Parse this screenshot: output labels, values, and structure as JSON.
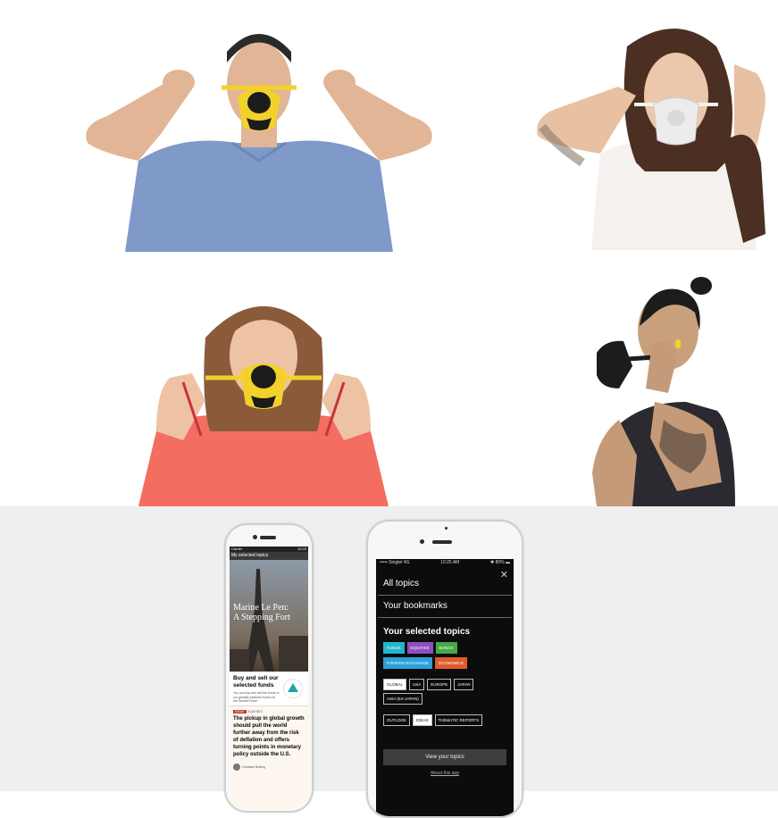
{
  "left_phone": {
    "status_left": "Carrier",
    "status_right": "10:25",
    "nav_label": "My selected topics",
    "hero_title": "Marine Le Pen: A Stepping Fort",
    "card_title": "Buy and sell our selected funds",
    "card_body": "You can buy and sell the funds of our globally selected funds via the Wealth Portal",
    "tag_label": "IDEAS",
    "tag_meta": "EQUITIES",
    "quote": "The pickup in global growth should pull the world further away from the risk of deflation and offers turning points in monetary policy outside the U.S.",
    "author": "Christian Nolting"
  },
  "right_phone": {
    "status_carrier": "••••• Singtel 4G",
    "status_time": "10:25 AM",
    "status_battery": "✱ 80% ▬",
    "close_icon": "close-icon",
    "menu": {
      "all_topics": "All topics",
      "bookmarks": "Your bookmarks"
    },
    "selected_heading": "Your selected topics",
    "chip_groups": [
      [
        {
          "label": "FUNDS",
          "color": "#23b5c9",
          "style": "filled"
        },
        {
          "label": "EQUITIES",
          "color": "#8e4fbf",
          "style": "filled"
        },
        {
          "label": "BONDS",
          "color": "#44a847",
          "style": "filled"
        }
      ],
      [
        {
          "label": "FOREIGN EXCHANGE",
          "color": "#2d9fd8",
          "style": "filled"
        },
        {
          "label": "ECONOMICS",
          "color": "#e05a2b",
          "style": "filled"
        }
      ],
      [
        {
          "label": "GLOBAL",
          "style": "selected"
        },
        {
          "label": "USA",
          "style": "outline"
        },
        {
          "label": "EUROPE",
          "style": "outline"
        },
        {
          "label": "JAPAN",
          "style": "outline"
        },
        {
          "label": "ASIA (EX-JAPAN)",
          "style": "outline"
        }
      ],
      [
        {
          "label": "OUTLOOK",
          "style": "outline"
        },
        {
          "label": "IDEAS",
          "style": "selected"
        },
        {
          "label": "THEMATIC REPORTS",
          "style": "outline"
        }
      ]
    ],
    "view_button": "View your topics",
    "about_link": "About this app"
  },
  "colors": {
    "mask_yellow": "#f2d22a",
    "mask_black": "#1c1c1c",
    "shirt_blue": "#7f99c9",
    "shirt_coral": "#f36e60",
    "screen_dark": "#0c0c0c"
  }
}
